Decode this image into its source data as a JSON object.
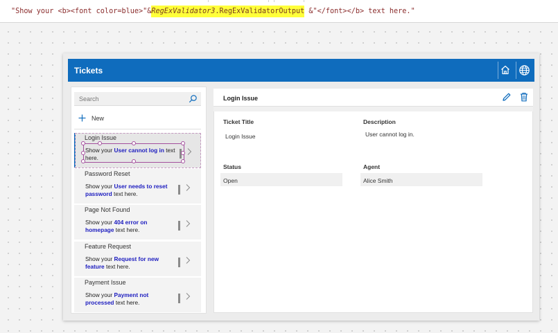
{
  "formula": {
    "pre": "\"Show your <b><font color=blue>\"&",
    "highlight_italic": "RegExValidator3",
    "highlight_plain": ".RegExValidatorOutput",
    "post": " &\"</font></b> text here.\""
  },
  "app": {
    "title": "Tickets",
    "header_color": "#0f6cbd",
    "icons": [
      "home-icon",
      "globe-icon"
    ]
  },
  "search": {
    "placeholder": "Search"
  },
  "new_button": {
    "label": "New"
  },
  "tickets": [
    {
      "title": "Login Issue",
      "prefix": "Show your ",
      "value": "User cannot log in",
      "suffix": " text here."
    },
    {
      "title": "Password Reset",
      "prefix": "Show your ",
      "value": "User needs to reset password",
      "suffix": " text here."
    },
    {
      "title": "Page Not Found",
      "prefix": "Show your ",
      "value": "404 error on homepage",
      "suffix": " text here."
    },
    {
      "title": "Feature Request",
      "prefix": "Show your ",
      "value": "Request for new feature",
      "suffix": " text here."
    },
    {
      "title": "Payment Issue",
      "prefix": "Show your ",
      "value": "Payment not processed",
      "suffix": " text here."
    }
  ],
  "detail": {
    "title": "Login Issue",
    "fields": {
      "ticket_title": {
        "label": "Ticket Title",
        "value": "Login Issue"
      },
      "description": {
        "label": "Description",
        "value": "User cannot log in."
      },
      "status": {
        "label": "Status",
        "value": "Open"
      },
      "agent": {
        "label": "Agent",
        "value": "Alice Smith"
      }
    },
    "icons": [
      "edit-icon",
      "delete-icon"
    ]
  }
}
